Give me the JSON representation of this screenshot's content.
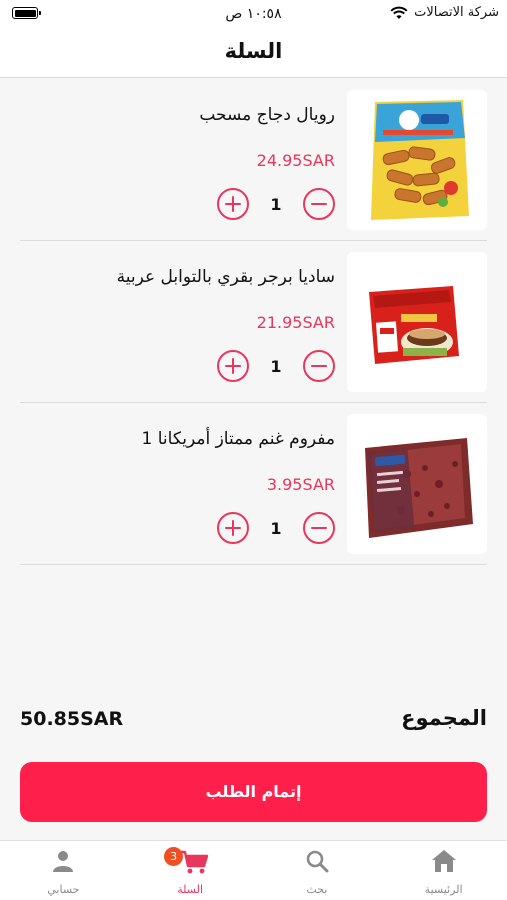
{
  "status_bar": {
    "time": "١٠:٥٨ ص",
    "carrier": "شركة الاتصالات"
  },
  "header": {
    "title": "السلة"
  },
  "cart": {
    "items": [
      {
        "name": "رويال دجاج مسحب",
        "price": "24.95SAR",
        "quantity": "1",
        "image_icon": "chicken-nuggets-package-icon"
      },
      {
        "name": "ساديا برجر بقري بالتوابل عربية",
        "price": "21.95SAR",
        "quantity": "1",
        "image_icon": "burger-package-icon"
      },
      {
        "name": "مفروم غنم ممتاز أمريكانا 1",
        "price": "3.95SAR",
        "quantity": "1",
        "image_icon": "minced-lamb-tray-icon"
      }
    ]
  },
  "summary": {
    "total_label": "المجموع",
    "total_value": "50.85SAR"
  },
  "checkout": {
    "label": "إتمام الطلب"
  },
  "tab_bar": {
    "tabs": [
      {
        "label": "حسابي",
        "icon": "person-icon"
      },
      {
        "label": "السلة",
        "icon": "cart-icon",
        "badge": "3"
      },
      {
        "label": "بحث",
        "icon": "search-icon"
      },
      {
        "label": "الرئيسية",
        "icon": "home-icon"
      }
    ]
  },
  "colors": {
    "accent": "#e8365d",
    "checkout_button": "#ff1f4b",
    "badge": "#f04e23",
    "background": "#f6f6f6"
  }
}
